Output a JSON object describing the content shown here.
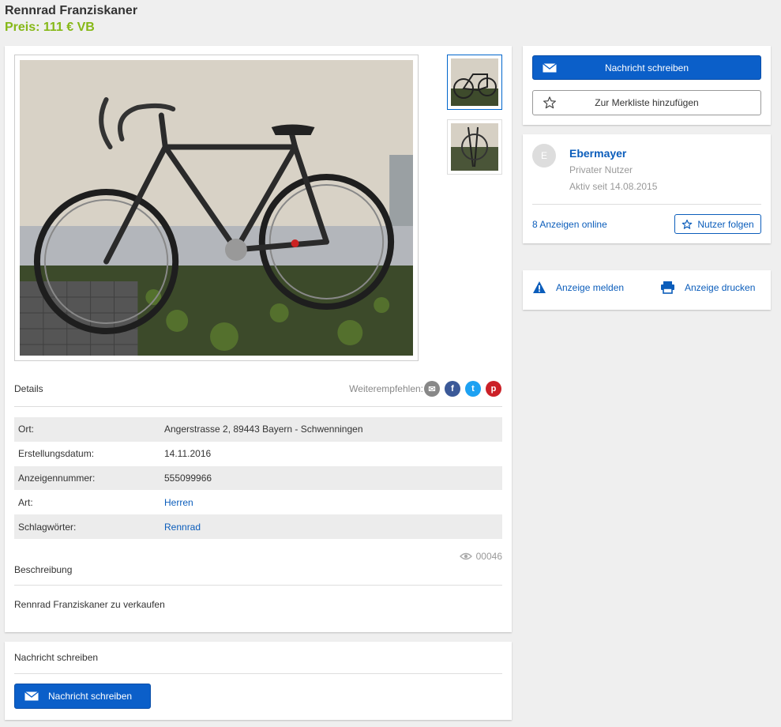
{
  "listing": {
    "title": "Rennrad Franziskaner",
    "price": "Preis: 111 € VB"
  },
  "gallery": {
    "thumbnails": [
      {
        "name": "thumbnail-1",
        "active": true
      },
      {
        "name": "thumbnail-2",
        "active": false
      }
    ]
  },
  "details": {
    "heading": "Details",
    "share_label": "Weiterempfehlen:",
    "share_buttons": [
      {
        "icon": "email-icon",
        "glyph": "✉",
        "color": "#888888"
      },
      {
        "icon": "facebook-icon",
        "glyph": "f",
        "color": "#3b5998"
      },
      {
        "icon": "twitter-icon",
        "glyph": "t",
        "color": "#1da1f2"
      },
      {
        "icon": "pinterest-icon",
        "glyph": "p",
        "color": "#cb2027"
      }
    ],
    "rows": [
      {
        "key": "Ort:",
        "value": "Angerstrasse 2, 89443 Bayern - Schwenningen",
        "link": false
      },
      {
        "key": "Erstellungsdatum:",
        "value": "14.11.2016",
        "link": false
      },
      {
        "key": "Anzeigennummer:",
        "value": "555099966",
        "link": false
      },
      {
        "key": "Art:",
        "value": "Herren",
        "link": true
      },
      {
        "key": "Schlagwörter:",
        "value": "Rennrad",
        "link": true
      }
    ],
    "views": "00046"
  },
  "description": {
    "heading": "Beschreibung",
    "text": "Rennrad Franziskaner zu verkaufen"
  },
  "message_section": {
    "heading": "Nachricht schreiben",
    "button_label": "Nachricht schreiben"
  },
  "actions": {
    "message_button": "Nachricht schreiben",
    "watchlist_button": "Zur Merkliste hinzufügen"
  },
  "seller": {
    "initial": "E",
    "name": "Ebermayer",
    "type": "Privater Nutzer",
    "active_since": "Aktiv seit 14.08.2015",
    "ads_online": "8 Anzeigen online",
    "follow_button": "Nutzer folgen"
  },
  "tools": {
    "report": "Anzeige melden",
    "print": "Anzeige drucken"
  },
  "colors": {
    "price": "#86b817",
    "primary": "#0b5fc9",
    "link": "#0b5dbb"
  }
}
